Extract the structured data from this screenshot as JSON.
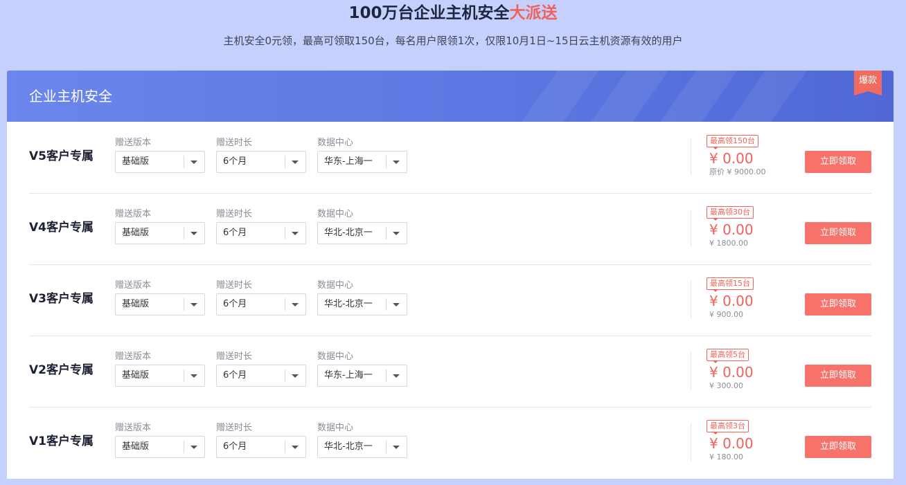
{
  "hero": {
    "title_main": "100万台企业主机安全",
    "title_highlight": "大派送",
    "subtitle": "主机安全0元领，最高可领取150台，每名用户限领1次，仅限10月1日~15日云主机资源有效的用户"
  },
  "card": {
    "title": "企业主机安全",
    "badge": "爆款",
    "field_labels": {
      "version": "赠送版本",
      "duration": "赠送时长",
      "datacenter": "数据中心"
    },
    "button_label": "立即领取"
  },
  "rows": [
    {
      "tier": "V5客户专属",
      "version": "基础版",
      "duration": "6个月",
      "datacenter": "华东-上海一",
      "limit": "最高领150台",
      "price": "¥ 0.00",
      "original": "原价 ¥ 9000.00"
    },
    {
      "tier": "V4客户专属",
      "version": "基础版",
      "duration": "6个月",
      "datacenter": "华北-北京一",
      "limit": "最高领30台",
      "price": "¥ 0.00",
      "original": "¥ 1800.00"
    },
    {
      "tier": "V3客户专属",
      "version": "基础版",
      "duration": "6个月",
      "datacenter": "华北-北京一",
      "limit": "最高领15台",
      "price": "¥ 0.00",
      "original": "¥ 900.00"
    },
    {
      "tier": "V2客户专属",
      "version": "基础版",
      "duration": "6个月",
      "datacenter": "华东-上海一",
      "limit": "最高领5台",
      "price": "¥ 0.00",
      "original": "¥ 300.00"
    },
    {
      "tier": "V1客户专属",
      "version": "基础版",
      "duration": "6个月",
      "datacenter": "华北-北京一",
      "limit": "最高领3台",
      "price": "¥ 0.00",
      "original": "¥ 180.00"
    }
  ],
  "colors": {
    "background": "#c5d0fc",
    "header": "#5b78e2",
    "accent": "#f0615b",
    "button": "#f6726a"
  }
}
